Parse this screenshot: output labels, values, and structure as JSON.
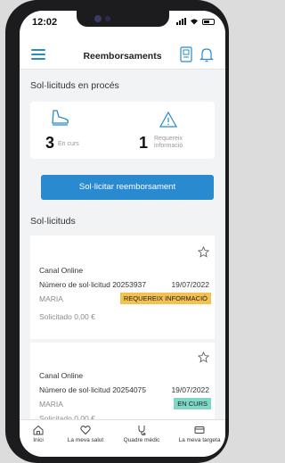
{
  "status": {
    "time": "12:02"
  },
  "header": {
    "title": "Reemborsaments"
  },
  "in_progress": {
    "heading": "Sol·licituds en procés",
    "in_course": {
      "count": "3",
      "label": "En curs"
    },
    "requires_info": {
      "count": "1",
      "label_line1": "Requereix",
      "label_line2": "informació"
    }
  },
  "request_button": {
    "label": "Sol·licitar reemborsament"
  },
  "requests": {
    "heading": "Sol·licituds",
    "items": [
      {
        "channel": "Canal Online",
        "number": "Número de sol·licitud 20253937",
        "date": "19/07/2022",
        "name": "MARIA",
        "status": "REQUEREIX INFORMACIÓ",
        "status_color": "#f2c14e",
        "amount": "Solicitado 0,00 €"
      },
      {
        "channel": "Canal Online",
        "number": "Número de sol·licitud 20254075",
        "date": "19/07/2022",
        "name": "MARIA",
        "status": "EN CURS",
        "status_color": "#7ed8c5",
        "amount": "Solicitado 0,00 €"
      }
    ]
  },
  "tabbar": {
    "items": [
      {
        "label": "Inici",
        "icon": "home-icon"
      },
      {
        "label": "La meva salut",
        "icon": "heart-icon"
      },
      {
        "label": "Quadre mèdic",
        "icon": "stethoscope-icon"
      },
      {
        "label": "La meva targeta",
        "icon": "card-icon"
      }
    ]
  },
  "colors": {
    "accent": "#2a8ad0",
    "warning_badge": "#f2c14e",
    "success_badge": "#7ed8c5"
  }
}
